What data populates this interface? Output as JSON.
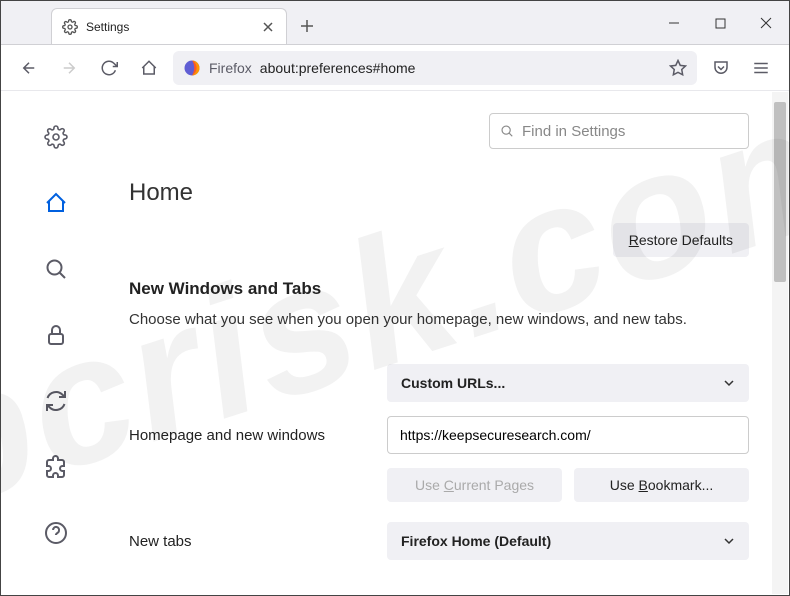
{
  "tab": {
    "title": "Settings"
  },
  "url": {
    "origin": "Firefox",
    "path": "about:preferences#home"
  },
  "search": {
    "placeholder": "Find in Settings"
  },
  "page": {
    "heading": "Home",
    "restore": "Restore Defaults",
    "restore_key": "R",
    "section_title": "New Windows and Tabs",
    "description": "Choose what you see when you open your homepage, new windows, and new tabs."
  },
  "homepage": {
    "label": "Homepage and new windows",
    "dropdown": "Custom URLs...",
    "url_value": "https://keepsecuresearch.com/",
    "use_current": "Use Current Pages",
    "use_current_key": "C",
    "use_bookmark": "Use Bookmark...",
    "use_bookmark_key": "B"
  },
  "newtabs": {
    "label": "New tabs",
    "dropdown": "Firefox Home (Default)"
  },
  "watermark": "pcrisk.com"
}
